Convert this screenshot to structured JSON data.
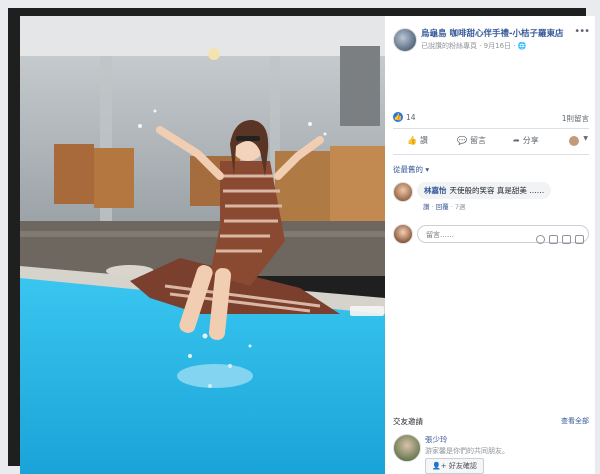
{
  "post": {
    "page_name": "烏龜島 咖啡甜心伴手禮-小桔子羅東店",
    "meta": "已說讚的粉絲專頁 · 9月16日 · ",
    "more": "•••"
  },
  "reactions": {
    "count": "14",
    "comments": "1則留言"
  },
  "actions": {
    "like": "讚",
    "comment": "留言",
    "share": "分享"
  },
  "sort_label": "從最舊的 ▾",
  "comments": [
    {
      "name": "林嘉怡",
      "text": "天使般的笑容 真是甜美 ……",
      "like": "讚",
      "reply": "回覆",
      "time": "7週"
    }
  ],
  "comment_input": {
    "placeholder": "留言……"
  },
  "suggestions": {
    "title": "交友邀請",
    "see_all": "查看全部",
    "person": {
      "name": "張少玲",
      "mutual": "游家馨是你們的共同朋友。",
      "add_label": "好友確認"
    }
  },
  "colors": {
    "link": "#365899",
    "pool": "#2fb8e6",
    "like_blue": "#1877f2"
  }
}
